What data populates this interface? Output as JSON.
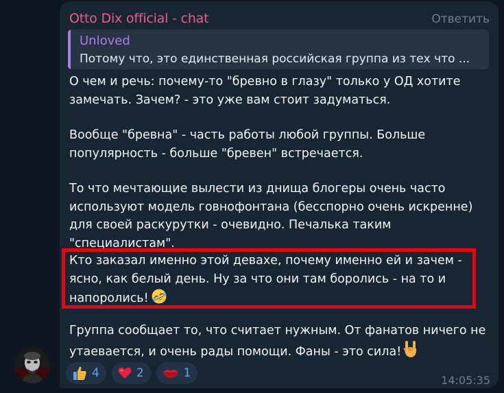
{
  "message": {
    "sender": "Otto Dix official - chat",
    "reply_button_label": "Ответить",
    "quote": {
      "author": "Unloved",
      "text": "Потому что, это единственная российская группа из тех что ..."
    },
    "paragraphs": [
      "О чем и речь: почему-то \"бревно в глазу\" только у ОД хотите замечать. Зачем? - это уже вам стоит задуматься.",
      "Вообще \"бревна\" - часть работы любой группы. Больше популярность - больше \"бревен\" встречается.",
      "То что мечтающие вылести из днища блогеры очень часто используют модель говнофонтана (бесспорно очень искренне) для своей раскурутки - очевидно. Печалька таким \"специалистам\".",
      "Кто заказал именно этой девахе, почему именно ей и зачем - ясно, как белый день. Ну за что они там боролись - на то и напоролись!",
      "Группа сообщает то, что считает нужным. От фанатов ничего не утаевается, и очень рады помощи. Фаны - это сила!"
    ],
    "emoji_icons": [
      "rofl-emoji-icon",
      "rock-hand-emoji-icon"
    ],
    "reactions": [
      {
        "icon": "thumbs-up-icon",
        "count": "4"
      },
      {
        "icon": "red-heart-icon",
        "count": "2"
      },
      {
        "icon": "kiss-lips-icon",
        "count": "1"
      }
    ],
    "time": "14:05:35"
  },
  "colors": {
    "background": "#0e1621",
    "bubble": "#182533",
    "sender": "#ee5c8c",
    "quote_accent": "#b179e8",
    "reaction_count": "#5aa7e0",
    "highlight_border": "#e30613"
  }
}
